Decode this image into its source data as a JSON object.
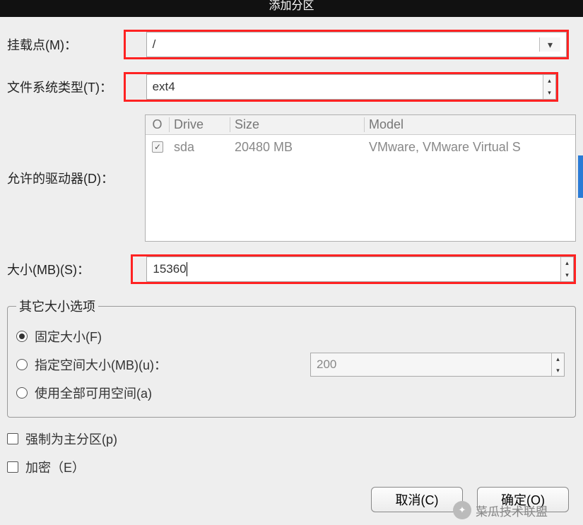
{
  "title": "添加分区",
  "mount": {
    "label": "挂载点(M)：",
    "value": "/"
  },
  "fs": {
    "label": "文件系统类型(T)：",
    "value": "ext4"
  },
  "drives": {
    "label": "允许的驱动器(D)：",
    "headers": {
      "check": "O",
      "drive": "Drive",
      "size": "Size",
      "model": "Model"
    },
    "rows": [
      {
        "checked": true,
        "drive": "sda",
        "size": "20480 MB",
        "model": "VMware, VMware Virtual S"
      }
    ]
  },
  "size": {
    "label": "大小(MB)(S)：",
    "value": "15360"
  },
  "other_size": {
    "legend": "其它大小选项",
    "fixed": "固定大小(F)",
    "upto": "指定空间大小(MB)(u)：",
    "upto_value": "200",
    "fill": "使用全部可用空间(a)",
    "selected": "fixed"
  },
  "force_primary": "强制为主分区(p)",
  "encrypt": "加密（E）",
  "buttons": {
    "cancel": "取消(C)",
    "ok": "确定(O)"
  },
  "watermark": "菜瓜技术联盟"
}
